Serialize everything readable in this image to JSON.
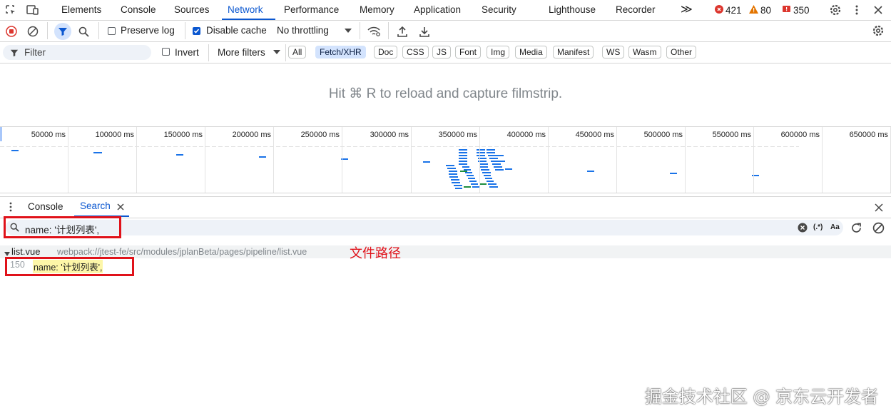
{
  "tabs": {
    "elements": "Elements",
    "console": "Console",
    "sources": "Sources",
    "network": "Network",
    "performance": "Performance",
    "memory": "Memory",
    "application": "Application",
    "security": "Security",
    "lighthouse": "Lighthouse",
    "recorder": "Recorder",
    "more": "≫"
  },
  "counts": {
    "errors": "421",
    "warnings": "80",
    "issues": "350"
  },
  "toolbar": {
    "preserve_log": "Preserve log",
    "disable_cache": "Disable cache",
    "throttling": "No throttling",
    "preserve_log_checked": false,
    "disable_cache_checked": true
  },
  "filterbar": {
    "filter_placeholder": "Filter",
    "invert": "Invert",
    "more_filters": "More filters",
    "chips": [
      "All",
      "Fetch/XHR",
      "Doc",
      "CSS",
      "JS",
      "Font",
      "Img",
      "Media",
      "Manifest",
      "WS",
      "Wasm",
      "Other"
    ],
    "active_chip": "Fetch/XHR"
  },
  "filmstrip": {
    "hint": "Hit ⌘ R to reload and capture filmstrip."
  },
  "overview": {
    "ticks": [
      "50000 ms",
      "100000 ms",
      "150000 ms",
      "200000 ms",
      "250000 ms",
      "300000 ms",
      "350000 ms",
      "400000 ms",
      "450000 ms",
      "500000 ms",
      "550000 ms",
      "600000 ms",
      "650000 ms"
    ]
  },
  "drawer": {
    "console_tab": "Console",
    "search_tab": "Search",
    "search_query": "name: '计划列表',",
    "regex_toggle": "(.*)",
    "case_toggle": "Aa"
  },
  "results": {
    "file_name": "list.vue",
    "file_path": "webpack://jtest-fe/src/modules/jplanBeta/pages/pipeline/list.vue",
    "annotation": "文件路径",
    "line_number": "150",
    "line_text": "name: '计划列表',"
  },
  "watermark": "掘金技术社区 @ 京东云开发者",
  "colors": {
    "accent": "#0b57d0",
    "error": "#dc362e",
    "warning": "#e37400",
    "annotation_red": "#e0121a",
    "highlight": "#fdf6a8"
  }
}
